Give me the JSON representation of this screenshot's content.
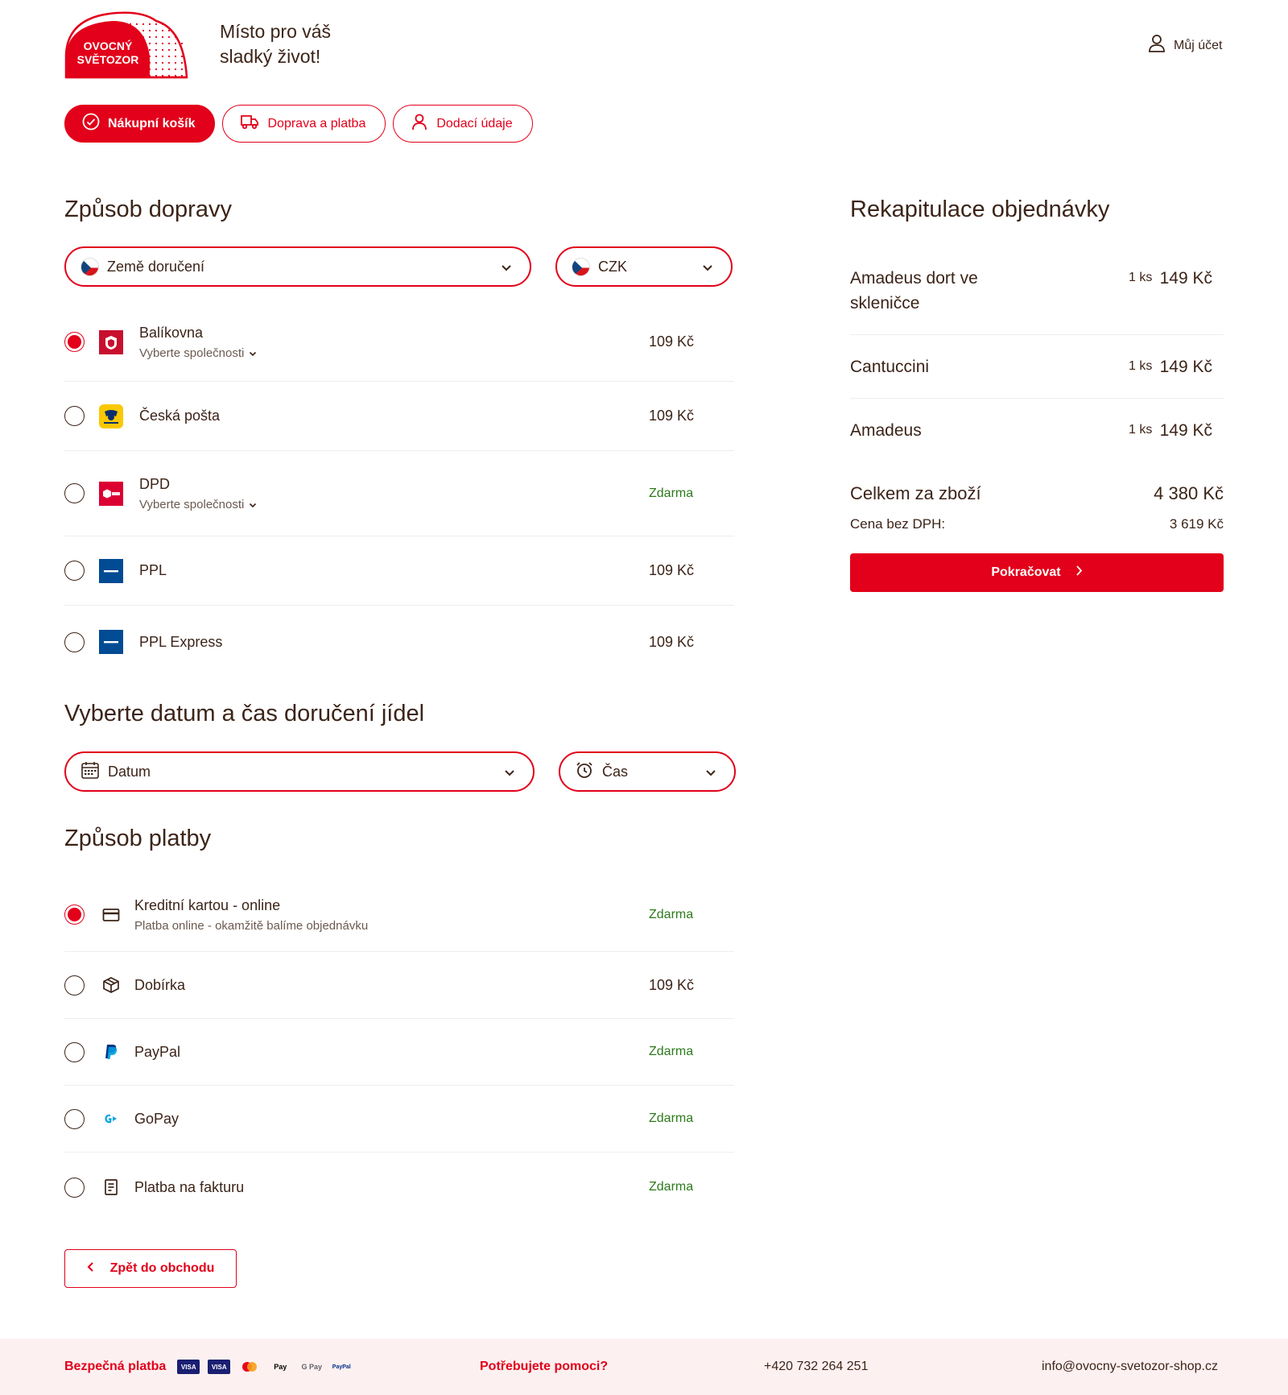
{
  "brand": {
    "line1": "OVOCNÝ",
    "line2": "SVĚTOZOR",
    "color": "#e2001a"
  },
  "header": {
    "tagline_1": "Místo pro váš",
    "tagline_2": "sladký život!",
    "account_label": "Můj účet"
  },
  "steps": [
    {
      "label": "Nákupní košík",
      "active": true
    },
    {
      "label": "Doprava a platba",
      "active": false
    },
    {
      "label": "Dodací údaje",
      "active": false
    }
  ],
  "shipping": {
    "title": "Způsob dopravy",
    "country_select": "Země doručení",
    "currency_select": "CZK",
    "options": [
      {
        "name": "Balíkovna",
        "sub": "Vyberte společnosti",
        "price": "109 Kč",
        "checked": true,
        "logo": "balikovna-logo"
      },
      {
        "name": "Česká pošta",
        "sub": "",
        "price": "109 Kč",
        "checked": false,
        "logo": "ceska-posta-logo"
      },
      {
        "name": "DPD",
        "sub": "Vyberte společnosti",
        "price": "Zdarma",
        "checked": false,
        "logo": "dpd-logo"
      },
      {
        "name": "PPL",
        "sub": "",
        "price": "109 Kč",
        "checked": false,
        "logo": "ppl-logo"
      },
      {
        "name": "PPL Express",
        "sub": "",
        "price": "109 Kč",
        "checked": false,
        "logo": "ppl-logo"
      }
    ]
  },
  "delivery_time": {
    "title": "Vyberte datum a čas doručení jídel",
    "date_select": "Datum",
    "time_select": "Čas"
  },
  "payment": {
    "title": "Způsob platby",
    "options": [
      {
        "name": "Kreditní kartou - online",
        "sub": "Platba online - okamžitě balíme objednávku",
        "price": "Zdarma",
        "checked": true,
        "icon": "credit-card-icon"
      },
      {
        "name": "Dobírka",
        "sub": "",
        "price": "109 Kč",
        "checked": false,
        "icon": "package-icon"
      },
      {
        "name": "PayPal",
        "sub": "",
        "price": "Zdarma",
        "checked": false,
        "icon": "paypal-icon"
      },
      {
        "name": "GoPay",
        "sub": "",
        "price": "Zdarma",
        "checked": false,
        "icon": "gopay-icon"
      },
      {
        "name": "Platba na fakturu",
        "sub": "",
        "price": "Zdarma",
        "checked": false,
        "icon": "invoice-icon"
      }
    ]
  },
  "back_label": "Zpět do obchodu",
  "summary": {
    "title": "Rekapitulace objednávky",
    "items": [
      {
        "name": "Amadeus dort ve skleničce",
        "qty": "1 ks",
        "price": "149 Kč"
      },
      {
        "name": "Cantuccini",
        "qty": "1 ks",
        "price": "149 Kč"
      },
      {
        "name": "Amadeus",
        "qty": "1 ks",
        "price": "149 Kč"
      }
    ],
    "total_label": "Celkem za zboží",
    "total_value": "4 380 Kč",
    "net_label": "Cena bez DPH:",
    "net_value": "3 619 Kč",
    "continue_label": "Pokračovat"
  },
  "footer": {
    "secure_label": "Bezpečná platba",
    "payment_marks": [
      "VISA",
      "VISA",
      "mastercard",
      "Pay",
      "G Pay",
      "PayPal"
    ],
    "help_label": "Potřebujete pomoci?",
    "phone": "+420 732 264 251",
    "email": "info@ovocny-svetozor-shop.cz"
  },
  "colors": {
    "accent": "#e2001a",
    "text": "#3c2418",
    "free": "#2d7a1b",
    "footer_bg": "#fdf0f1"
  }
}
